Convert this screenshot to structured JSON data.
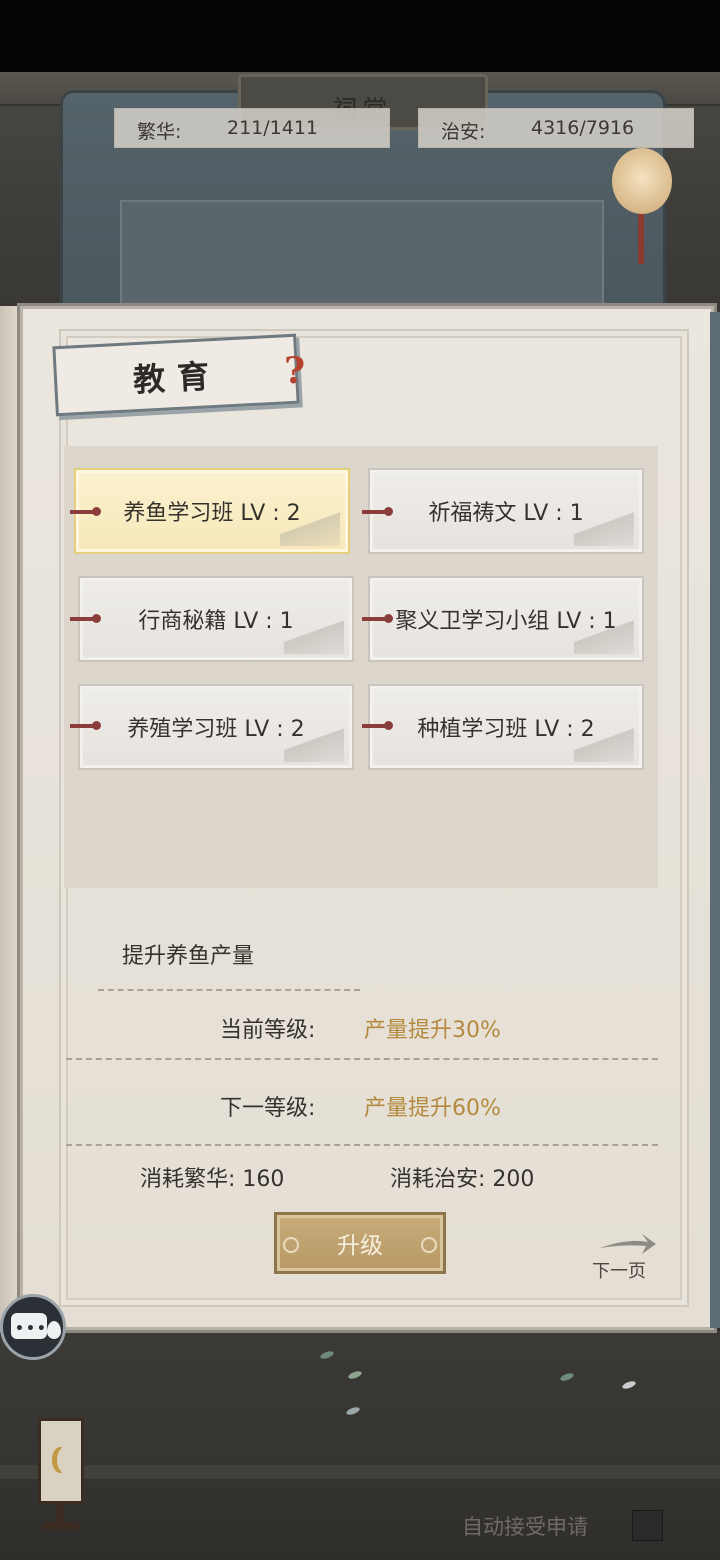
{
  "header": {
    "plaque_text": "祠堂",
    "prosperity": {
      "label": "繁华:",
      "value": "211/1411"
    },
    "security": {
      "label": "治安:",
      "value": "4316/7916"
    }
  },
  "panel": {
    "title": "教育",
    "help_icon": "question-mark-icon",
    "skills": [
      {
        "label": "养鱼学习班 LV : 2",
        "selected": true
      },
      {
        "label": "祈福祷文 LV : 1",
        "selected": false
      },
      {
        "label": "行商秘籍 LV : 1",
        "selected": false
      },
      {
        "label": "聚义卫学习小组 LV : 1",
        "selected": false
      },
      {
        "label": "养殖学习班 LV : 2",
        "selected": false
      },
      {
        "label": "种植学习班 LV : 2",
        "selected": false
      }
    ],
    "description": "提升养鱼产量",
    "current_level": {
      "label": "当前等级:",
      "value": "产量提升30%"
    },
    "next_level": {
      "label": "下一等级:",
      "value": "产量提升60%"
    },
    "cost_prosperity": "消耗繁华:  160",
    "cost_security": "消耗治安:  200",
    "upgrade_label": "升级",
    "next_page_label": "下一页"
  },
  "footer": {
    "auto_accept_label": "自动接受申请",
    "auto_accept_checked": false
  },
  "colors": {
    "value_gold": "#b48a3e",
    "selected_bg": "#f6e8b9",
    "button_gold": "#c8ac7a",
    "pin_red": "#8a3d3a"
  }
}
